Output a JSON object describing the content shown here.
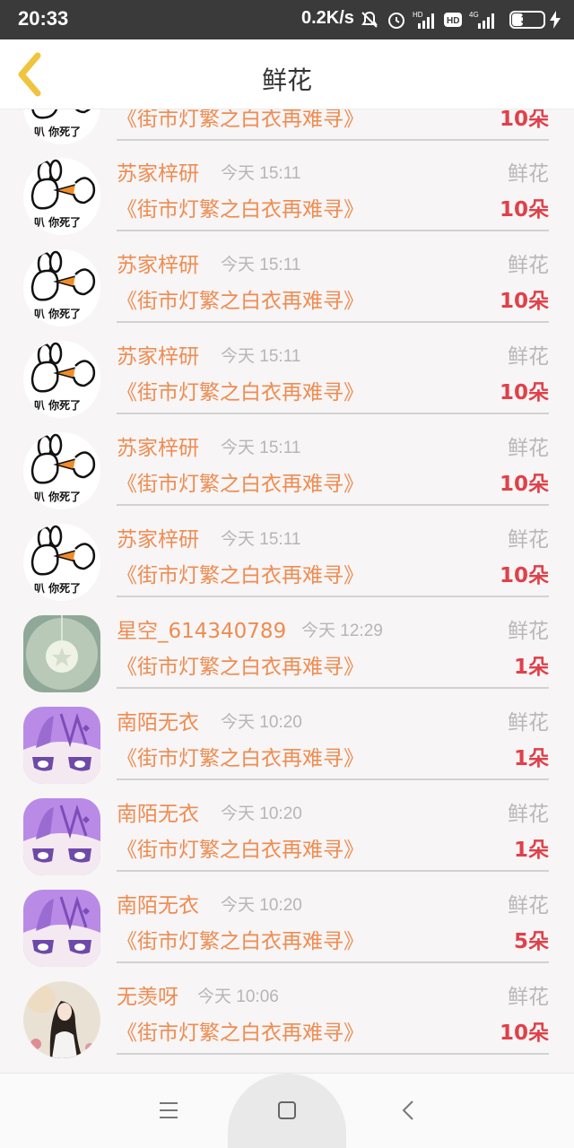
{
  "status_bar": {
    "time": "20:33",
    "network_speed": "0.2K/s",
    "battery": "31",
    "battery_level_percent": 31,
    "icons": [
      "mute-icon",
      "alarm-icon",
      "hd-signal-icon",
      "hd-badge-icon",
      "4g-signal-icon",
      "battery-icon",
      "charging-icon"
    ]
  },
  "header": {
    "back_icon": "chevron-left-icon",
    "title": "鲜花"
  },
  "list": {
    "first_partial": {
      "book": "《街市灯繁之白衣再难寻》",
      "count": "10朵",
      "avatar": "cartoon-bunny"
    },
    "items": [
      {
        "name": "苏家梓研",
        "time": "今天 15:11",
        "type": "鲜花",
        "book": "《街市灯繁之白衣再难寻》",
        "count": "10朵",
        "avatar": "cartoon-bunny"
      },
      {
        "name": "苏家梓研",
        "time": "今天 15:11",
        "type": "鲜花",
        "book": "《街市灯繁之白衣再难寻》",
        "count": "10朵",
        "avatar": "cartoon-bunny"
      },
      {
        "name": "苏家梓研",
        "time": "今天 15:11",
        "type": "鲜花",
        "book": "《街市灯繁之白衣再难寻》",
        "count": "10朵",
        "avatar": "cartoon-bunny"
      },
      {
        "name": "苏家梓研",
        "time": "今天 15:11",
        "type": "鲜花",
        "book": "《街市灯繁之白衣再难寻》",
        "count": "10朵",
        "avatar": "cartoon-bunny"
      },
      {
        "name": "苏家梓研",
        "time": "今天 15:11",
        "type": "鲜花",
        "book": "《街市灯繁之白衣再难寻》",
        "count": "10朵",
        "avatar": "cartoon-bunny"
      },
      {
        "name": "星空_614340789",
        "time": "今天 12:29",
        "type": "鲜花",
        "book": "《街市灯繁之白衣再难寻》",
        "count": "1朵",
        "avatar": "star-lamp"
      },
      {
        "name": "南陌无衣",
        "time": "今天 10:20",
        "type": "鲜花",
        "book": "《街市灯繁之白衣再难寻》",
        "count": "1朵",
        "avatar": "purple-anime"
      },
      {
        "name": "南陌无衣",
        "time": "今天 10:20",
        "type": "鲜花",
        "book": "《街市灯繁之白衣再难寻》",
        "count": "1朵",
        "avatar": "purple-anime"
      },
      {
        "name": "南陌无衣",
        "time": "今天 10:20",
        "type": "鲜花",
        "book": "《街市灯繁之白衣再难寻》",
        "count": "5朵",
        "avatar": "purple-anime"
      },
      {
        "name": "无羡呀",
        "time": "今天 10:06",
        "type": "鲜花",
        "book": "《街市灯繁之白衣再难寻》",
        "count": "10朵",
        "avatar": "painted-girl"
      }
    ]
  },
  "nav_bar": {
    "icons": [
      "menu-icon",
      "home-square-icon",
      "back-triangle-icon"
    ]
  },
  "colors": {
    "accent_orange": "#ee8c52",
    "count_red": "#e0404a",
    "status_bar_bg": "#3a3a3a",
    "back_chevron": "#f0c43c"
  }
}
